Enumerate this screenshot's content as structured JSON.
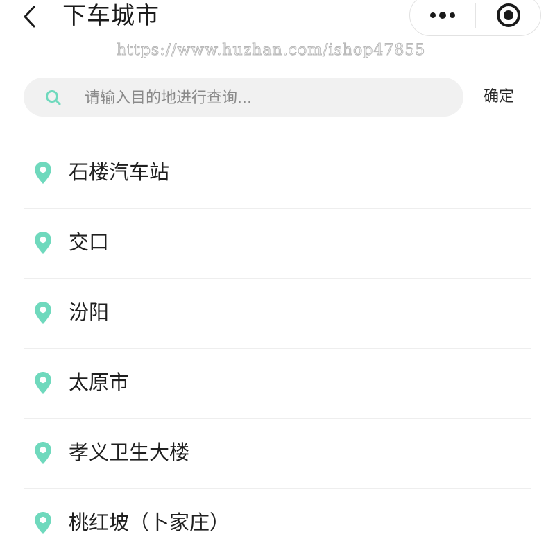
{
  "header": {
    "title": "下车城市",
    "back_icon": "chevron-left-icon",
    "more_icon": "more-dots-icon",
    "close_icon": "target-circle-icon"
  },
  "watermark": "https://www.huzhan.com/ishop47855",
  "search": {
    "placeholder": "请输入目的地进行查询...",
    "value": "",
    "icon": "search-icon",
    "confirm_label": "确定"
  },
  "colors": {
    "accent": "#6fd9bd",
    "text": "#1f1f1f",
    "placeholder": "#8a8a8a",
    "search_bg": "#f1f1f1",
    "divider": "#eeeeee"
  },
  "cities": [
    {
      "name": "石楼汽车站",
      "icon": "location-pin-icon"
    },
    {
      "name": "交口",
      "icon": "location-pin-icon"
    },
    {
      "name": "汾阳",
      "icon": "location-pin-icon"
    },
    {
      "name": "太原市",
      "icon": "location-pin-icon"
    },
    {
      "name": "孝义卫生大楼",
      "icon": "location-pin-icon"
    },
    {
      "name": "桃红坡（卜家庄）",
      "icon": "location-pin-icon"
    }
  ]
}
